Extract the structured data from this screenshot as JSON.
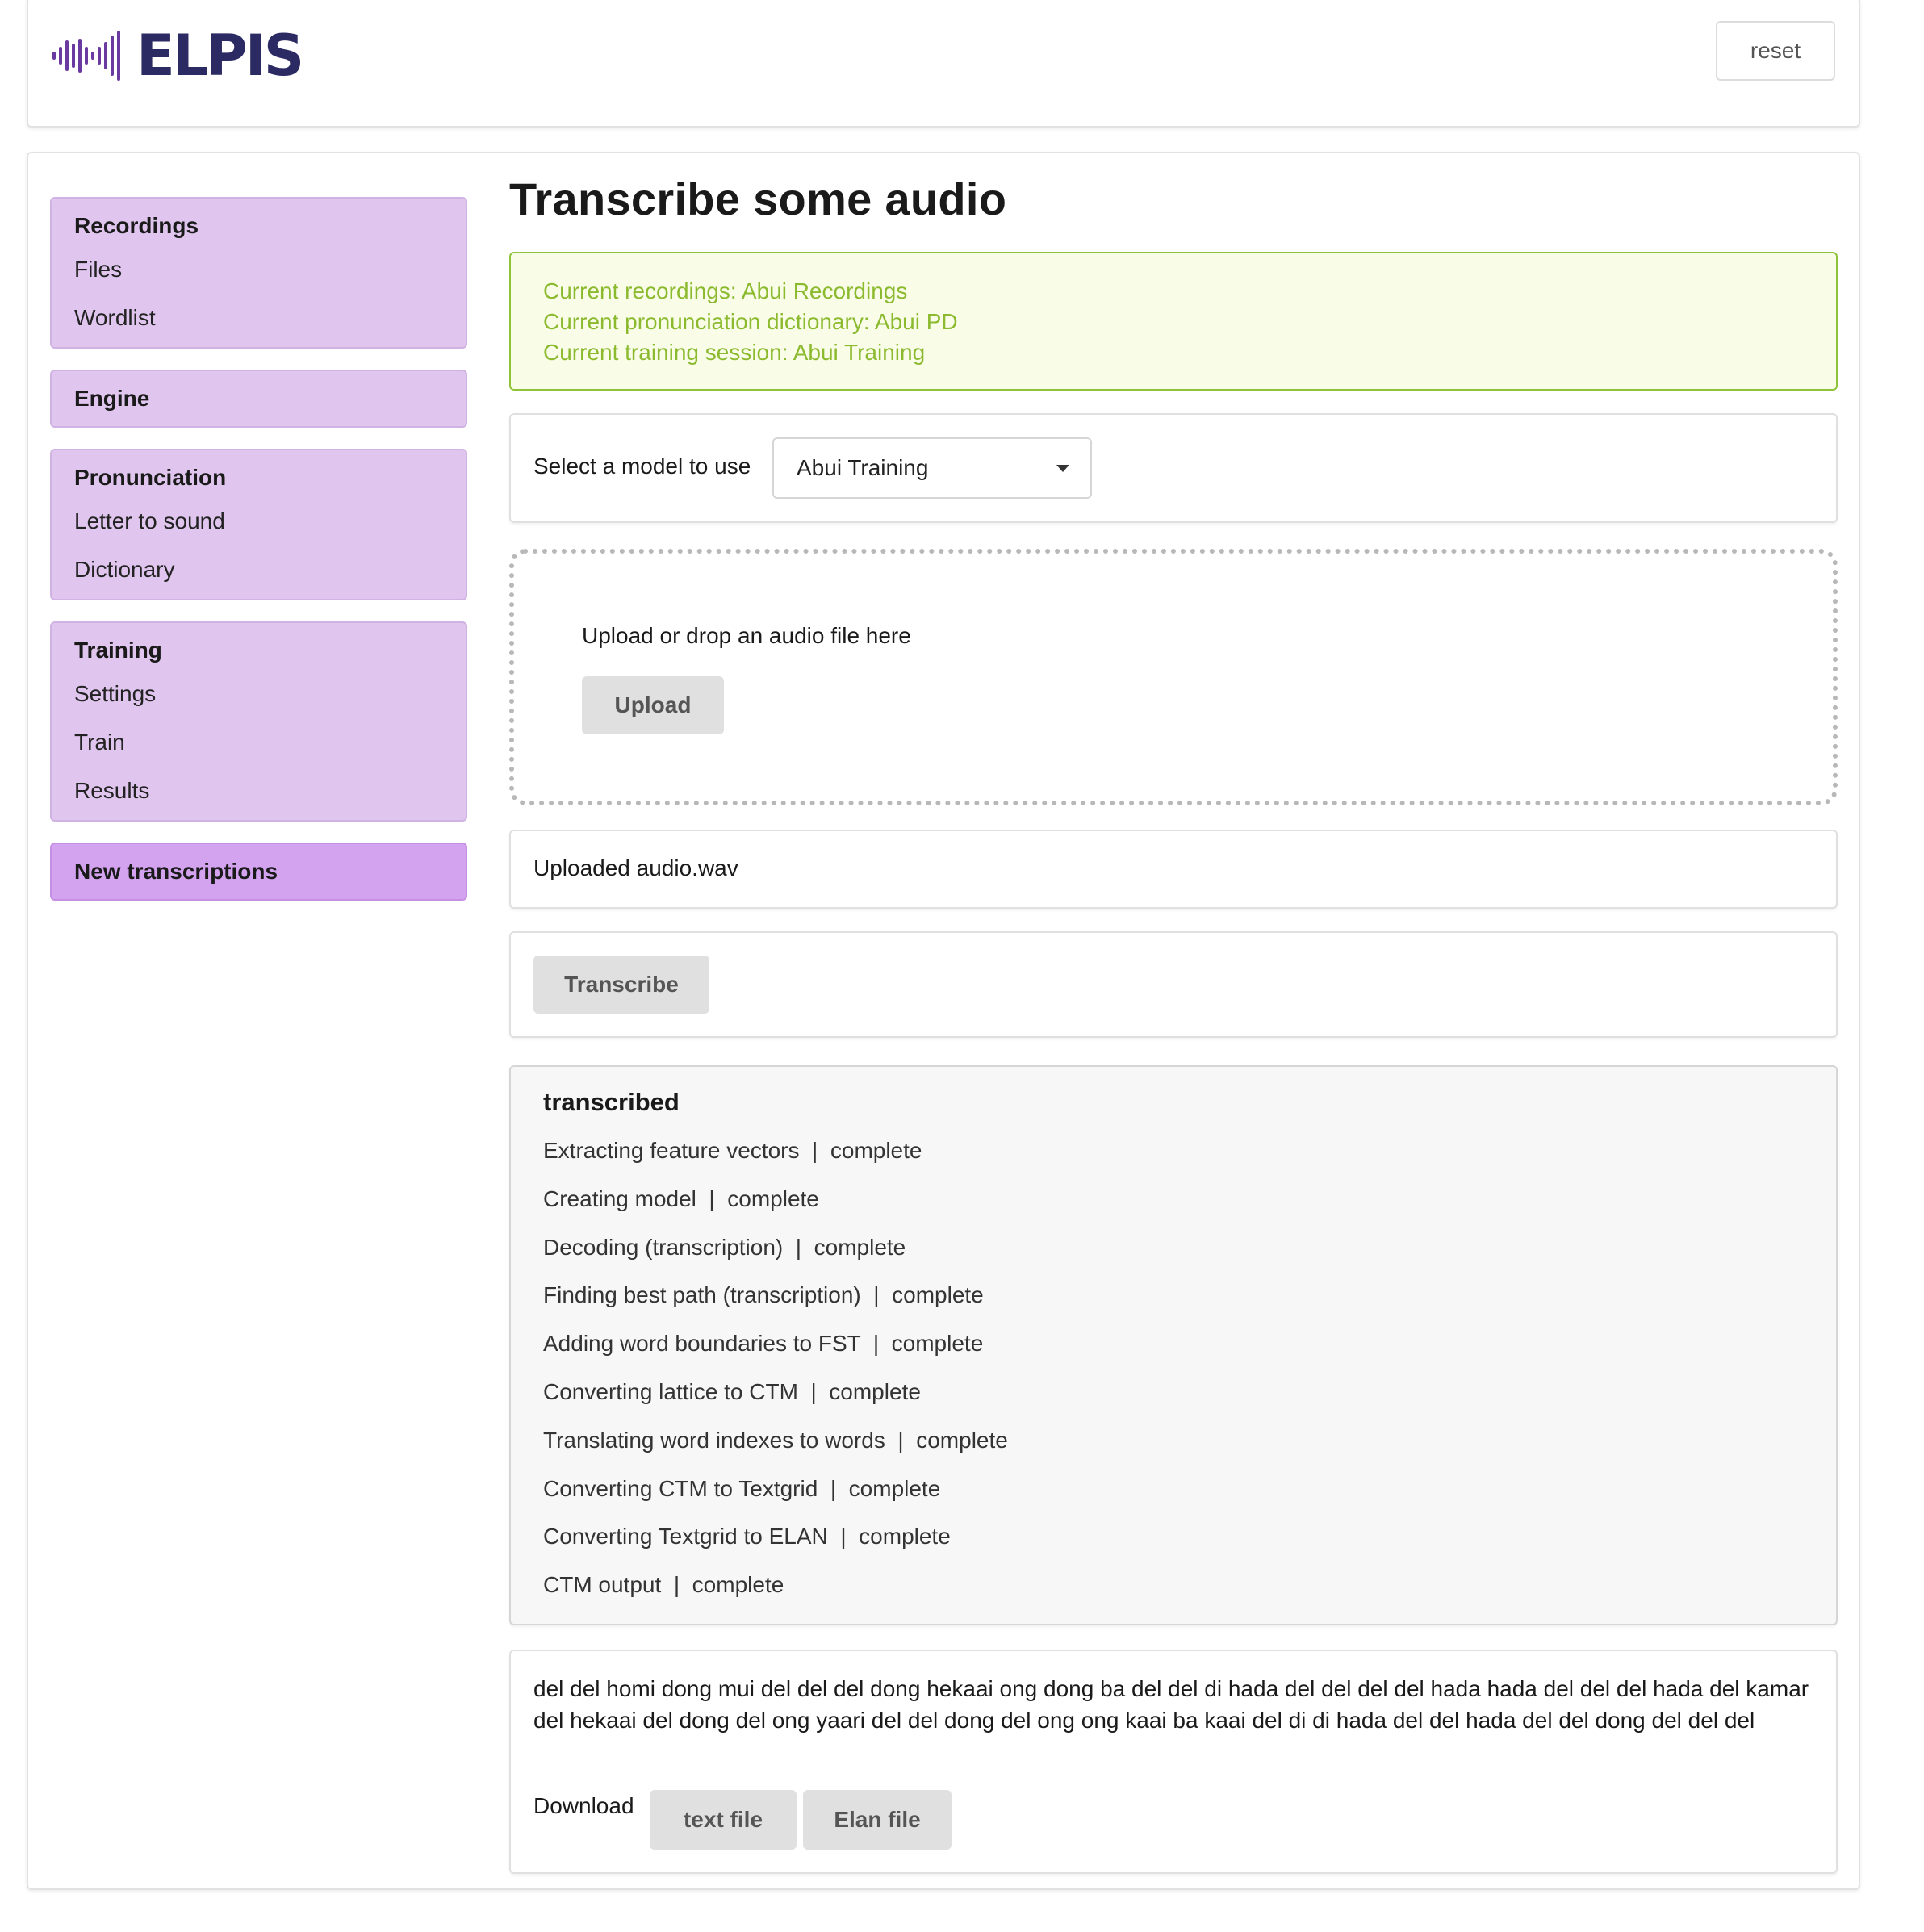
{
  "header": {
    "logo_text": "ELPIS",
    "reset_label": "reset"
  },
  "sidebar": {
    "groups": [
      {
        "heading": "Recordings",
        "items": [
          "Files",
          "Wordlist"
        ]
      },
      {
        "heading": "Engine",
        "items": []
      },
      {
        "heading": "Pronunciation",
        "items": [
          "Letter to sound",
          "Dictionary"
        ]
      },
      {
        "heading": "Training",
        "items": [
          "Settings",
          "Train",
          "Results"
        ]
      },
      {
        "heading": "New transcriptions",
        "items": [],
        "active": true
      }
    ]
  },
  "main": {
    "title": "Transcribe some audio",
    "info": {
      "recordings": "Current recordings: Abui Recordings",
      "dictionary": "Current pronunciation dictionary: Abui PD",
      "session": "Current training session: Abui Training"
    },
    "model_select": {
      "label": "Select a model to use",
      "value": "Abui Training"
    },
    "upload": {
      "prompt": "Upload or drop an audio file here",
      "button": "Upload"
    },
    "uploaded": "Uploaded audio.wav",
    "transcribe_button": "Transcribe",
    "status": {
      "title": "transcribed",
      "rows": [
        "Extracting feature vectors  |  complete",
        "Creating model  |  complete",
        "Decoding (transcription)  |  complete",
        "Finding best path (transcription)  |  complete",
        "Adding word boundaries to FST  |  complete",
        "Converting lattice to CTM  |  complete",
        "Translating word indexes to words  |  complete",
        "Converting CTM to Textgrid  |  complete",
        "Converting Textgrid to ELAN  |  complete",
        "CTM output  |  complete"
      ]
    },
    "result": {
      "text": "del del homi dong mui del del del dong hekaai ong dong ba del del di hada del del del del hada hada del del del hada del kamar del hekaai del dong del ong yaari del del dong del ong ong kaai ba kaai del di di hada del del hada del del dong del del del",
      "download_label": "Download",
      "text_file_button": "text file",
      "elan_file_button": "Elan file"
    }
  },
  "colors": {
    "nav_bg": "#e0c6ee",
    "nav_active_bg": "#d4a3f0",
    "info_text": "#8cba2f",
    "info_border": "#8fc33a",
    "logo_purple": "#6b3aa0",
    "logo_navy": "#2b2a63"
  }
}
